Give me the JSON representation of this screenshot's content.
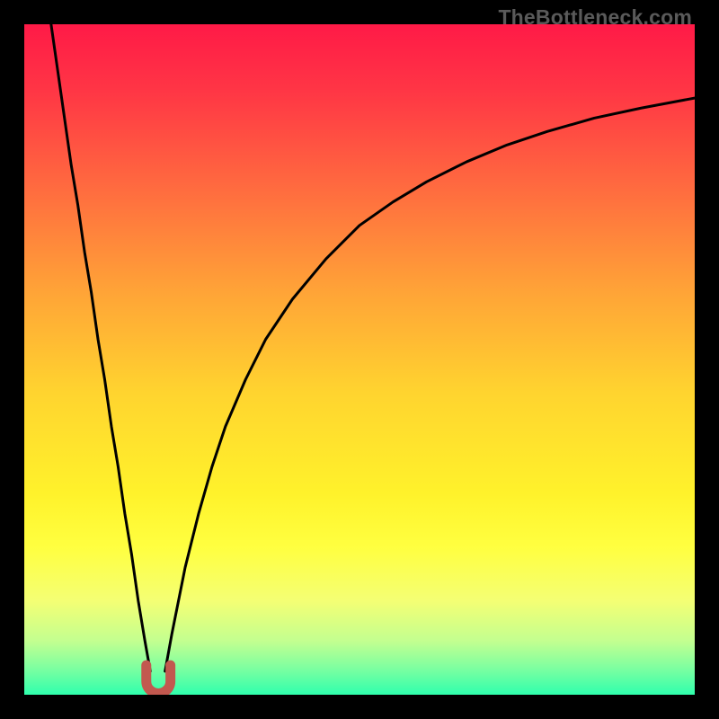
{
  "watermark": "TheBottleneck.com",
  "chart_data": {
    "type": "line",
    "title": "",
    "xlabel": "",
    "ylabel": "",
    "xlim": [
      0,
      100
    ],
    "ylim": [
      0,
      100
    ],
    "grid": false,
    "legend": false,
    "watermark": "TheBottleneck.com",
    "gradient_stops": [
      {
        "offset": 0.0,
        "color": "#ff1a47"
      },
      {
        "offset": 0.1,
        "color": "#ff3645"
      },
      {
        "offset": 0.25,
        "color": "#ff6d3f"
      },
      {
        "offset": 0.4,
        "color": "#ffa437"
      },
      {
        "offset": 0.55,
        "color": "#ffd42f"
      },
      {
        "offset": 0.7,
        "color": "#fff22b"
      },
      {
        "offset": 0.78,
        "color": "#ffff40"
      },
      {
        "offset": 0.86,
        "color": "#f4ff74"
      },
      {
        "offset": 0.92,
        "color": "#c3ff90"
      },
      {
        "offset": 0.96,
        "color": "#7effa0"
      },
      {
        "offset": 1.0,
        "color": "#2fffad"
      }
    ],
    "series": [
      {
        "name": "left-branch",
        "color": "#000000",
        "x": [
          4,
          5,
          6,
          7,
          8,
          9,
          10,
          11,
          12,
          13,
          14,
          15,
          16,
          17,
          18,
          18.8
        ],
        "y": [
          100,
          93,
          86,
          79,
          73,
          66,
          60,
          53,
          47,
          40,
          34,
          27,
          21,
          14,
          8,
          3.5
        ]
      },
      {
        "name": "right-branch",
        "color": "#000000",
        "x": [
          21,
          22,
          24,
          26,
          28,
          30,
          33,
          36,
          40,
          45,
          50,
          55,
          60,
          66,
          72,
          78,
          85,
          92,
          100
        ],
        "y": [
          3.5,
          9,
          19,
          27,
          34,
          40,
          47,
          53,
          59,
          65,
          70,
          73.5,
          76.5,
          79.5,
          82,
          84,
          86,
          87.5,
          89
        ]
      }
    ],
    "annotations": [
      {
        "name": "valley-marker",
        "shape": "u",
        "color": "#c2584f",
        "x_center": 20,
        "y_center": 2.3,
        "width": 3.6,
        "height": 4.2
      }
    ]
  }
}
